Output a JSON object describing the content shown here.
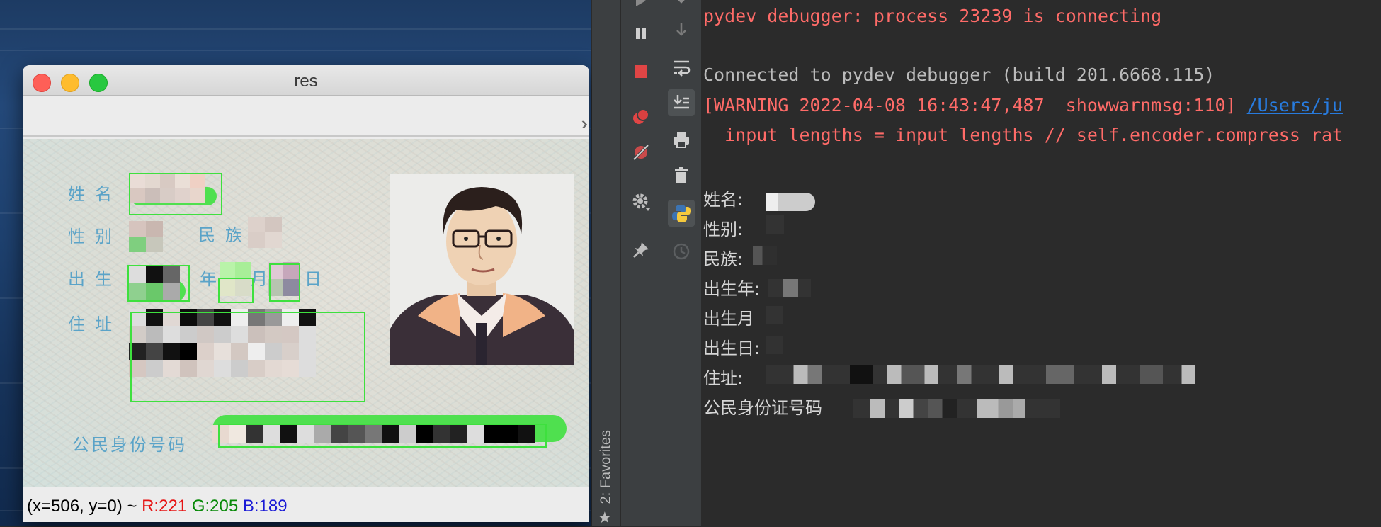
{
  "window": {
    "title": "res"
  },
  "card": {
    "labels": {
      "name": "姓名",
      "sex": "性别",
      "ethnicity": "民族",
      "birth": "出生",
      "year": "年",
      "month": "月",
      "day": "日",
      "address": "住址",
      "id_number": "公民身份号码"
    }
  },
  "status_bar": {
    "coords": "(x=506, y=0) ~ ",
    "r": "R:221",
    "g": "G:205",
    "b": "B:189"
  },
  "ide": {
    "favorites_tab": "2: Favorites",
    "toolbar_icons": [
      "step-into-icon",
      "step-over-icon",
      "pause-icon",
      "stop-icon",
      "view-breakpoints-icon",
      "mute-breakpoints-icon",
      "settings-icon",
      "pin-icon",
      "soft-wrap-icon",
      "scroll-to-end-icon",
      "print-icon",
      "trash-icon",
      "python-console-icon",
      "history-icon"
    ]
  },
  "console": {
    "line1": "pydev debugger: process 23239 is connecting",
    "line2": "Connected to pydev debugger (build 201.6668.115)",
    "line3_prefix": "[WARNING 2022-04-08 16:43:47,487 _showwarnmsg:110] ",
    "line3_link": "/Users/ju",
    "line4": "  input_lengths = input_lengths // self.encoder.compress_rat",
    "outputs": {
      "name": "姓名:",
      "sex": "性别:",
      "ethnicity": "民族:",
      "birth_year": "出生年:",
      "birth_month": "出生月",
      "birth_day": "出生日:",
      "address": "住址:",
      "id_number": "公民身份证号码"
    }
  },
  "colors": {
    "error_text": "#ff6b68",
    "link": "#287bde",
    "console_bg": "#2b2b2b",
    "detect_box": "#3ee03e"
  }
}
